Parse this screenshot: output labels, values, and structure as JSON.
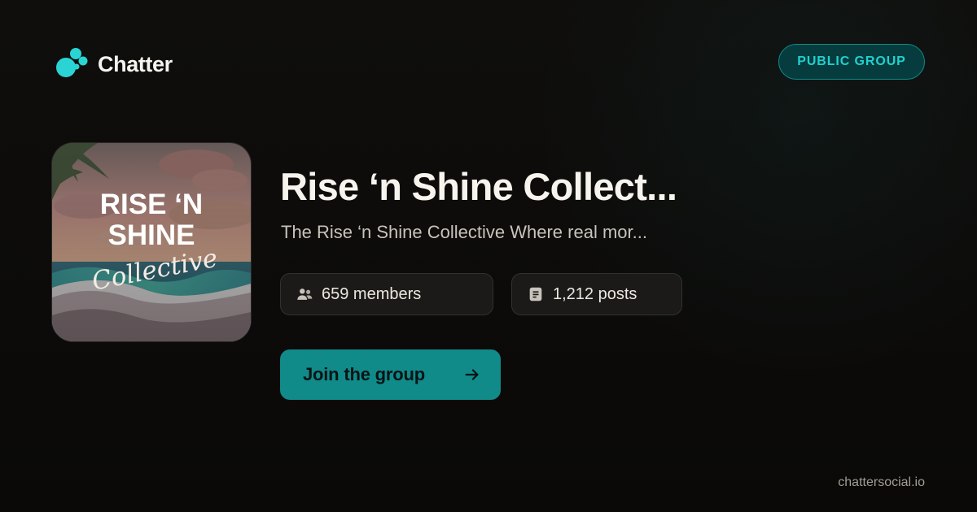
{
  "brand": {
    "name": "Chatter",
    "accent": "#2ad4d4",
    "logo_icon": "chatter-bubbles-icon"
  },
  "badge": {
    "label": "PUBLIC GROUP"
  },
  "group": {
    "title": "Rise ‘n Shine Collect...",
    "description": "The Rise ‘n Shine Collective Where real mor...",
    "cover": {
      "line1": "RISE ‘N",
      "line2": "SHINE",
      "script": "Collective"
    },
    "members_text": "659 members",
    "posts_text": "1,212 posts",
    "members_icon": "people-icon",
    "posts_icon": "document-icon"
  },
  "cta": {
    "label": "Join the group",
    "icon": "arrow-right-icon"
  },
  "footer": {
    "domain": "chattersocial.io"
  },
  "colors": {
    "background": "#0d0c0a",
    "badge_bg": "#063c3d",
    "badge_text": "#22d0d0",
    "button_bg": "#118a8a",
    "stat_bg": "#1b1a18"
  }
}
